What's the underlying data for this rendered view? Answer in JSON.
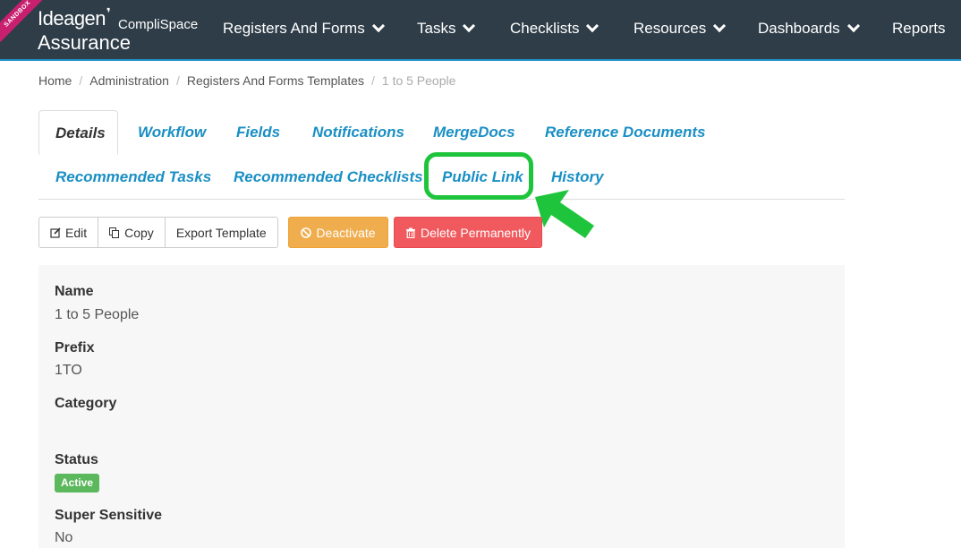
{
  "app": {
    "sandbox_label": "SANDBOX",
    "logo_line1": "Ideagen",
    "logo_brand": "CompliSpace",
    "logo_line2": "Assurance"
  },
  "nav": {
    "items": [
      {
        "label": "Registers And Forms",
        "has_dropdown": true
      },
      {
        "label": "Tasks",
        "has_dropdown": true
      },
      {
        "label": "Checklists",
        "has_dropdown": true
      },
      {
        "label": "Resources",
        "has_dropdown": true
      },
      {
        "label": "Dashboards",
        "has_dropdown": true
      },
      {
        "label": "Reports",
        "has_dropdown": false
      }
    ]
  },
  "breadcrumb": [
    "Home",
    "Administration",
    "Registers And Forms Templates",
    "1 to 5 People"
  ],
  "tabs": {
    "row1": [
      "Details",
      "Workflow",
      "Fields",
      "Notifications",
      "MergeDocs",
      "Reference Documents"
    ],
    "row2": [
      "Recommended Tasks",
      "Recommended Checklists",
      "Public Link",
      "History"
    ],
    "active": "Details",
    "highlighted": "Public Link"
  },
  "actions": {
    "edit": "Edit",
    "copy": "Copy",
    "export": "Export Template",
    "deactivate": "Deactivate",
    "delete": "Delete Permanently"
  },
  "details": {
    "name_label": "Name",
    "name_value": "1 to 5 People",
    "prefix_label": "Prefix",
    "prefix_value": "1TO",
    "category_label": "Category",
    "category_value": "",
    "status_label": "Status",
    "status_value": "Active",
    "super_sensitive_label": "Super Sensitive",
    "super_sensitive_value": "No"
  },
  "colors": {
    "navbar": "#2e3d48",
    "tab_link": "#1a8fc4",
    "warning": "#f0ad4e",
    "danger": "#f05a5e",
    "success": "#5cb85c",
    "highlight": "#1ec53c",
    "sandbox_ribbon": "#c8206f"
  }
}
